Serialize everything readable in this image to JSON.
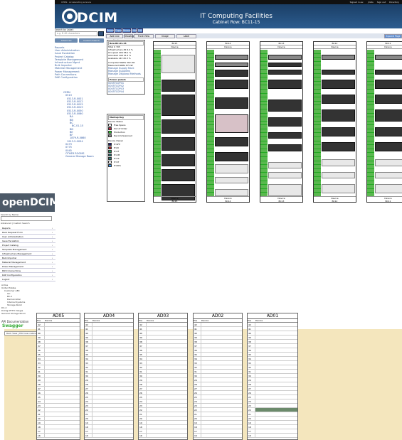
{
  "topbar": {
    "org": "CERN · Accelerating science",
    "links": [
      "Signed in as: ",
      "jmills",
      "Sign out",
      "Directory"
    ]
  },
  "header": {
    "logo": "DCIM",
    "title": "IT Computing Facilities",
    "subtitle": "Cabinet Row: BC11-15"
  },
  "left": {
    "search_label": "Search by Label:",
    "search_placeholder": "e.g. B 40 characters",
    "advanced_btn": "Advanced",
    "custom_btn": "Custom Search",
    "nav": [
      "Reports",
      "User Administration",
      "Issue Escalation",
      "Project Catalog",
      "Template Management",
      "Infrastructure Mgmt",
      "Bulk Importer",
      "Material Management",
      "Power Management",
      "Path Connections",
      "DAE Configuration"
    ],
    "tree": [
      "CERN",
      "0513",
      "0513-R-0001",
      "0513-R-0012",
      "0513-R-0015",
      "0513-R-0019",
      "0513-R-0050",
      "0513-R-0060",
      "BA",
      "BB",
      "BC",
      "BC-01-15",
      "BD",
      "BE",
      "BF",
      "1879-R-0860",
      "1913-5-0054",
      "0473",
      "0775",
      "0045",
      "OTHER ROOMS",
      "General Storage Room"
    ]
  },
  "toolbar": {
    "tabs": [
      "Reports",
      "Export",
      "Rename",
      "Add",
      "Edit"
    ],
    "tabs2": [
      "Add new cabinet",
      "Showing",
      "Front View",
      "Image",
      "Label"
    ],
    "right": "Expand Page"
  },
  "info": {
    "title": "Row BC-01-15",
    "lines": [
      "Total U 705",
      "Infrastructure 45 6.4 %",
      "Occupied 409 58.1 %",
      "Allocated 108 15.3 %",
      "Available 143 20.3 %"
    ],
    "power": [
      "Computed Watts 302 kW",
      "Measured Watts 87 kW"
    ],
    "links": [
      "Manage Supply Rack",
      "Manage Suppliers",
      "Manage Disposal Methods"
    ],
    "power_panels_title": "Power panels",
    "panels": [
      "0005TC0P41",
      "0005TC0P42",
      "0005TC0P43",
      "0005TC0P44"
    ]
  },
  "key": {
    "title": "Markup Key",
    "status_title": "Device Status",
    "statuses": [
      {
        "label": "Free Space",
        "color": "#ffffff"
      },
      {
        "label": "Out of Order",
        "color": "#cc2244"
      },
      {
        "label": "Production",
        "color": "#22cc22"
      },
      {
        "label": "Decommissioned",
        "color": "#888888"
      }
    ],
    "owner_title": "Device Owner",
    "owners": [
      {
        "label": "IT-SFP",
        "color": "#1a1a7a"
      },
      {
        "label": "IT-DI",
        "color": "#aa2222"
      },
      {
        "label": "IT-CF",
        "color": "#22aa66"
      },
      {
        "label": "IT-CM",
        "color": "#226666"
      },
      {
        "label": "IT-CS",
        "color": "#2c7f7f"
      },
      {
        "label": "IT-ST",
        "color": "#ffffff"
      },
      {
        "label": "IT-NCS",
        "color": "#40a0ff"
      }
    ]
  },
  "cabinets": [
    {
      "name": "BC15",
      "header": "Device"
    },
    {
      "name": "BC14",
      "header": "Device"
    },
    {
      "name": "BC13",
      "header": "Device"
    },
    {
      "name": "BC12",
      "header": "Device"
    },
    {
      "name": "BC11",
      "header": "Device"
    }
  ],
  "open_dcim": {
    "logo": "openDCIM",
    "search_label": "Search by Name:",
    "tabs": "Advanced | Custom Search",
    "menu": [
      "Reports",
      "Rack Request Form",
      "User Administration",
      "Issue Escalation",
      "Project Catalog",
      "Template Management",
      "Infrastructure Management",
      "Bulk Importer",
      "Material Management",
      "Power Management",
      "Path Connections",
      "DAE Configuration",
      "Logout"
    ],
    "tree": [
      "Active",
      "United States",
      "Customer ABC",
      "GC",
      "BC-2",
      "Demarcation",
      "Internal Systems",
      "Storage Room",
      "DC-2",
      "DI-Digi PTTH Vizsgia",
      "General Storage Room"
    ],
    "footer1": "API Documentation",
    "footer2": "Swagger"
  },
  "bottom": {
    "tabs": "Rack View | Edit new cabinet",
    "subtabs": "Images | Labels | Both",
    "columns": [
      "AD05",
      "AD04",
      "AD03",
      "AD02",
      "AD01"
    ],
    "pos": "Pos",
    "dev": "Device",
    "rows": [
      "42",
      "41",
      "40",
      "39",
      "38",
      "37",
      "36",
      "35",
      "34",
      "33",
      "32",
      "31",
      "30",
      "29",
      "28",
      "27",
      "26",
      "25",
      "24",
      "23",
      "22",
      "21",
      "20",
      "19",
      "18",
      "17",
      "16"
    ]
  }
}
